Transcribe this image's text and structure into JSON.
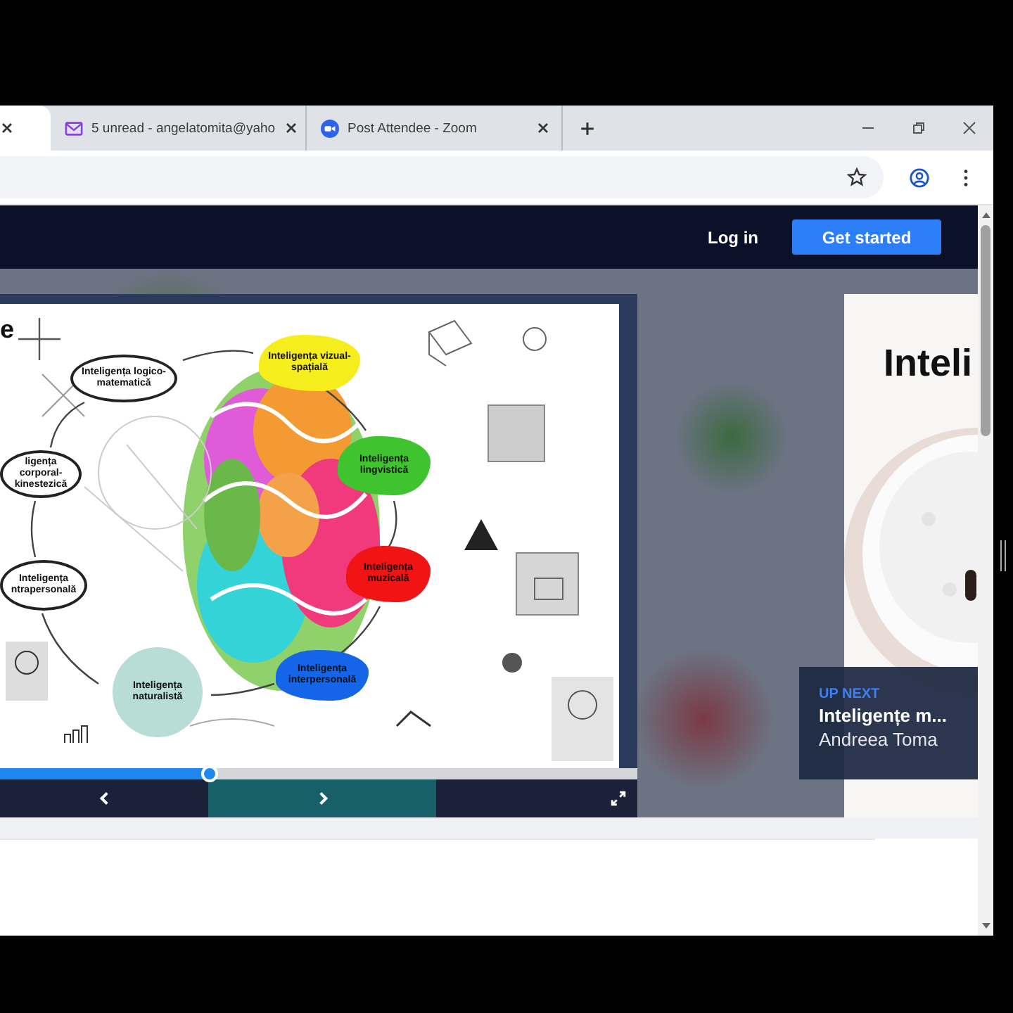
{
  "browser": {
    "tabs": [
      {
        "kind": "cut",
        "selected": true
      },
      {
        "kind": "tab",
        "title": "5 unread - angelatomita@yaho",
        "selected": false
      },
      {
        "kind": "tab",
        "title": "Post Attendee - Zoom",
        "selected": false
      }
    ]
  },
  "header": {
    "login": "Log in",
    "cta": "Get started"
  },
  "slide": {
    "title_fragment": "e",
    "labels": [
      {
        "kind": "oval",
        "text": "Inteligența logico-matematică"
      },
      {
        "kind": "splash",
        "text": "Inteligența vizual-spațială",
        "color": "#f6ee1c"
      },
      {
        "kind": "oval",
        "text": "ligența corporal-kinestezică"
      },
      {
        "kind": "splash",
        "text": "Inteligența lingvistică",
        "color": "#3fc430"
      },
      {
        "kind": "oval",
        "text": "Inteligența ntrapersonală"
      },
      {
        "kind": "splash",
        "text": "Inteligența muzicală",
        "color": "#f01414"
      },
      {
        "kind": "splash",
        "text": "Inteligența interpersonală",
        "color": "#1565e8"
      },
      {
        "kind": "circle",
        "text": "Inteligența naturalistă"
      }
    ],
    "progress": {
      "level": 0.33
    }
  },
  "up_next_card": {
    "heading": "Inteli",
    "label": "UP NEXT",
    "title": "Inteligențe m...",
    "author": "Andreea Toma"
  }
}
